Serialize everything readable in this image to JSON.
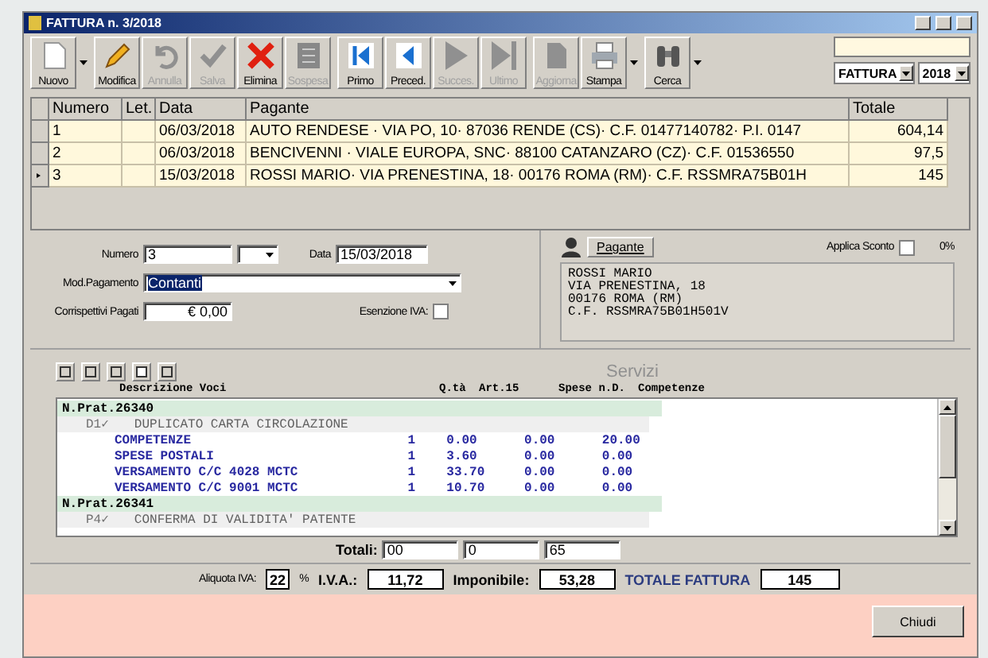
{
  "window": {
    "title": "FATTURA n. 3/2018"
  },
  "toolbar": [
    {
      "label": "Nuovo",
      "disabled": false,
      "menu": true
    },
    {
      "label": "Modifica",
      "disabled": false,
      "menu": false
    },
    {
      "label": "Annulla",
      "disabled": true,
      "menu": false
    },
    {
      "label": "Salva",
      "disabled": true,
      "menu": false
    },
    {
      "label": "Elimina",
      "disabled": false,
      "menu": false
    },
    {
      "label": "Sospesa",
      "disabled": true,
      "menu": false
    },
    {
      "label": "Primo",
      "disabled": false,
      "menu": false
    },
    {
      "label": "Preced.",
      "disabled": false,
      "menu": false
    },
    {
      "label": "Succes.",
      "disabled": true,
      "menu": false
    },
    {
      "label": "Ultimo",
      "disabled": true,
      "menu": false
    },
    {
      "label": "Aggiorna",
      "disabled": true,
      "menu": false
    },
    {
      "label": "Stampa",
      "disabled": false,
      "menu": true
    },
    {
      "label": "Cerca",
      "disabled": false,
      "menu": true
    }
  ],
  "doc_type": {
    "value": "FATTURA"
  },
  "year": {
    "value": "2018"
  },
  "table": {
    "columns": [
      "Numero",
      "Let.",
      "Data",
      "Pagante",
      "Totale"
    ],
    "rows": [
      {
        "cells": [
          "1",
          "",
          "06/03/2018",
          "AUTO RENDESE · VIA PO, 10· 87036 RENDE (CS)· C.F. 01477140782· P.I. 0147",
          "604,14"
        ],
        "selected": false
      },
      {
        "cells": [
          "2",
          "",
          "06/03/2018",
          "BENCIVENNI · VIALE EUROPA, SNC· 88100 CATANZARO (CZ)· C.F. 01536550",
          "97,5"
        ],
        "selected": false
      },
      {
        "cells": [
          "3",
          "",
          "15/03/2018",
          "ROSSI MARIO· VIA PRENESTINA, 18· 00176 ROMA (RM)· C.F. RSSMRA75B01H",
          "145"
        ],
        "selected": true
      }
    ]
  },
  "form": {
    "numero_label": "Numero",
    "numero": "3",
    "data_label": "Data",
    "data": "15/03/2018",
    "pagamento_label": "Mod.Pagamento",
    "pagamento": "Contanti",
    "corrispettivi_label": "Corrispettivi Pagati",
    "corrispettivi": "€ 0,00",
    "esenzione_label": "Esenzione IVA:",
    "esenzione": false
  },
  "payer": {
    "button": "Pagante",
    "sconto_label": "Applica Sconto",
    "sconto": false,
    "sconto_value": "0%",
    "address": [
      "ROSSI MARIO",
      "VIA PRENESTINA, 18",
      "00176 ROMA (RM)",
      "C.F. RSSMRA75B01H501V"
    ]
  },
  "services": {
    "title": "Servizi",
    "columns": [
      "Descrizione Voci",
      "Q.tà",
      "Art.15",
      "Spese n.D.",
      "Competenze"
    ],
    "tree": [
      {
        "label": "N.Prat.26340",
        "children": [
          {
            "label": "D1✓",
            "desc": "DUPLICATO CARTA CIRCOLAZIONE",
            "children": [
              {
                "label": "COMPETENZE",
                "values": [
                  "1",
                  "0.00",
                  "0.00",
                  "20.00"
                ]
              },
              {
                "label": "SPESE POSTALI",
                "values": [
                  "1",
                  "3.60",
                  "0.00",
                  "0.00"
                ]
              },
              {
                "label": "VERSAMENTO C/C 4028 MCTC",
                "values": [
                  "1",
                  "33.70",
                  "0.00",
                  "0.00"
                ]
              },
              {
                "label": "VERSAMENTO C/C 9001 MCTC",
                "values": [
                  "1",
                  "10.70",
                  "0.00",
                  "0.00"
                ]
              }
            ]
          }
        ]
      },
      {
        "label": "N.Prat.26341",
        "children": [
          {
            "label": "P4✓",
            "desc": "CONFERMA DI VALIDITA' PATENTE"
          }
        ]
      }
    ]
  },
  "totals": {
    "label": "Totali:",
    "values": [
      "00",
      "0",
      "65"
    ]
  },
  "summary": {
    "aliquota_label": "Aliquota IVA:",
    "aliquota": "22",
    "percent": "%",
    "iva_label": "I.V.A.:",
    "iva": "11,72",
    "imponibile_label": "Imponibile:",
    "imponibile": "53,28",
    "totale_label": "TOTALE FATTURA",
    "totale": "145"
  },
  "close_button": "Chiudi"
}
